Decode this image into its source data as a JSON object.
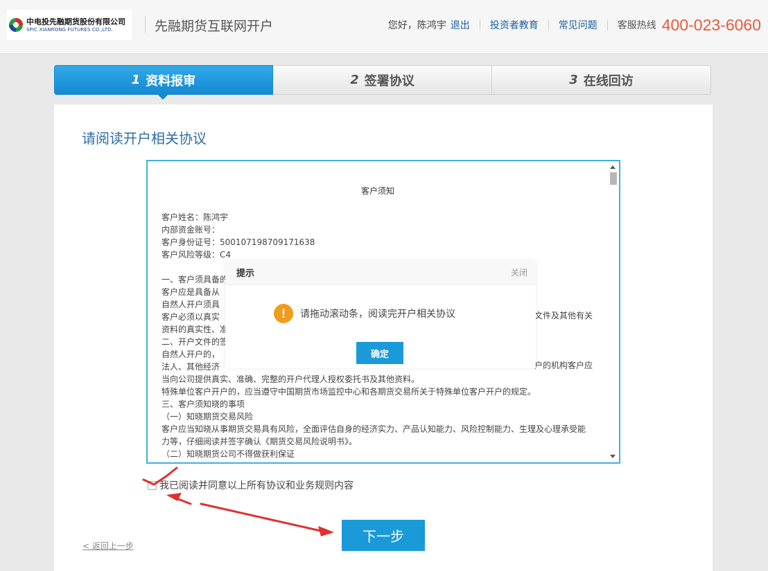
{
  "header": {
    "logo_cn": "中电投先融期货股份有限公司",
    "logo_en": "SPIC XIANRONG FUTURES CO.,LTD.",
    "site_title": "先融期货互联网开户",
    "greeting": "您好，陈鸿宇",
    "logout": "退出",
    "investor_edu": "投资者教育",
    "faq": "常见问题",
    "hotline_label": "客服热线",
    "hotline": "400-023-6060"
  },
  "steps": [
    {
      "num": "1",
      "label": "资料报审",
      "active": true
    },
    {
      "num": "2",
      "label": "签署协议",
      "active": false
    },
    {
      "num": "3",
      "label": "在线回访",
      "active": false
    }
  ],
  "main": {
    "section_title": "请阅读开户相关协议",
    "doc": {
      "title": "客户须知",
      "lines": [
        "客户姓名：陈鸿宇",
        "内部资金账号：",
        "客户身份证号：500107198709171638",
        "客户风险等级：C4",
        "",
        "一、客户须具备的",
        "  客户应是具备从",
        "  自然人开户须具",
        "  客户必须以真实",
        "资料的真实性、准",
        "二、开户文件的签",
        "  自然人开户的，",
        "  法人、其他经济",
        "当向公司提供真实、准确、完整的开户代理人授权委托书及其他资料。",
        "  特殊单位客户开户的，应当遵守中国期货市场监控中心和各期货交易所关于特殊单位客户开户的规定。",
        "三、客户须知晓的事项",
        "  （一）知晓期货交易风险",
        "  客户应当知晓从事期货交易具有风险，全面评估自身的经济实力、产品认知能力、风险控制能力、生理及心理承受能",
        "力等，仔细阅读并签字确认《期货交易风险说明书》。",
        "  （二）知晓期货公司不得做获利保证"
      ],
      "right_fragment_1": "文件及其他有关",
      "right_fragment_2": "户的机构客户应"
    },
    "modal": {
      "title": "提示",
      "close": "关闭",
      "message": "请拖动滚动条，阅读完开户相关协议",
      "ok": "确定",
      "icon": "!"
    },
    "agree_label": "我已阅读并同意以上所有协议和业务规则内容",
    "agree_checked": false,
    "next_button": "下一步",
    "back_link": "< 返回上一步"
  },
  "colors": {
    "accent": "#1a9ad9",
    "hotline": "#e85a3c",
    "title": "#2d6da3",
    "annotation": "#e03030"
  }
}
